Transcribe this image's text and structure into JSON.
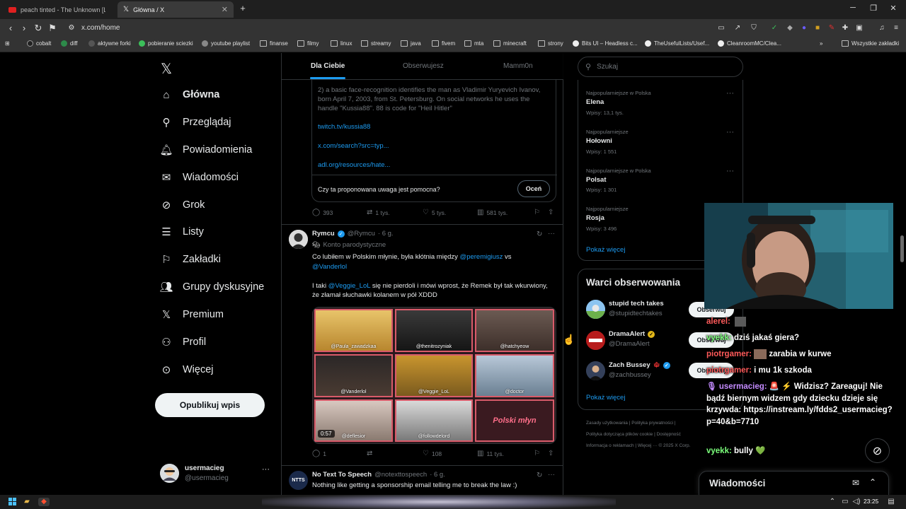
{
  "browser": {
    "tabs": [
      {
        "title": "peach tinted - The Unknown [Lyr"
      },
      {
        "title": "Główna / X"
      }
    ],
    "url": "x.com/home",
    "bookmarks": [
      "cobalt",
      "diff",
      "aktywne forki",
      "pobieranie sciezki",
      "youtube playlist",
      "finanse",
      "filmy",
      "linux",
      "streamy",
      "java",
      "fivem",
      "mta",
      "minecraft",
      "strony",
      "Bits UI – Headless c...",
      "TheUsefulLists/Usef...",
      "CleanroomMC/Clea...",
      "Wszystkie zakładki"
    ]
  },
  "sidebar": {
    "items": [
      {
        "label": "Główna",
        "icon": "home-icon"
      },
      {
        "label": "Przeglądaj",
        "icon": "search-icon"
      },
      {
        "label": "Powiadomienia",
        "icon": "bell-icon"
      },
      {
        "label": "Wiadomości",
        "icon": "mail-icon"
      },
      {
        "label": "Grok",
        "icon": "grok-icon"
      },
      {
        "label": "Listy",
        "icon": "list-icon"
      },
      {
        "label": "Zakładki",
        "icon": "bookmark-icon"
      },
      {
        "label": "Grupy dyskusyjne",
        "icon": "communities-icon"
      },
      {
        "label": "Premium",
        "icon": "x-logo-icon"
      },
      {
        "label": "Profil",
        "icon": "person-icon"
      },
      {
        "label": "Więcej",
        "icon": "more-circle-icon"
      }
    ],
    "post_button": "Opublikuj wpis",
    "account": {
      "name": "usermacieg",
      "handle": "@usermacieg"
    }
  },
  "feed": {
    "tabs": [
      "Dla Ciebie",
      "Obserwujesz",
      "Mamm0n"
    ],
    "note": {
      "text": "2) a basic face-recognition identifies the man as Vladimir Yuryevich Ivanov, born April 7, 2003, from St. Petersburg. On social networks he uses the handle \"Kussia88\". 88 is code for \"Heil Hitler\"",
      "links": [
        "twitch.tv/kussia88",
        "x.com/search?src=typ...",
        "adl.org/resources/hate..."
      ],
      "question": "Czy ta proponowana uwaga jest pomocna?",
      "rate_button": "Oceń"
    },
    "tweet1_actions": {
      "replies": "393",
      "reposts": "1 tys.",
      "likes": "5 tys.",
      "views": "581 tys."
    },
    "tweet2": {
      "name": "Rymcu",
      "handle": "@Rymcu",
      "time": "· 6 g.",
      "label": "Konto parodystyczne",
      "line1_a": "Co lubiłem w Polskim młynie, była kłótnia między ",
      "mention1": "@peremigiusz",
      "line1_b": " vs",
      "mention2": "@Vanderlol",
      "line2_a": "I taki ",
      "mention3": "@Veggie_LoL",
      "line2_b": " się nie pierdoli i mówi wprost, że Remek był tak wkurwiony, że złamał słuchawki kolanem w pół XDDD",
      "media_labels": [
        "@Paula_zawadzkaa",
        "@thenitrozyniak",
        "@hatchyeow",
        "@Vanderlol",
        "@Veggie_LoL",
        "@doctor",
        "@deflesior",
        "@followdelord",
        "Polski młyn"
      ],
      "duration": "0:57",
      "actions": {
        "replies": "1",
        "reposts": "",
        "likes": "108",
        "views": "11 tys."
      }
    },
    "tweet3": {
      "name": "No Text To Speech",
      "handle": "@notexttospeech",
      "time": "· 6 g.",
      "text": "Nothing like getting a sponsorship email telling me to break the law :)",
      "avatar_text": "NTTS"
    }
  },
  "right": {
    "search_placeholder": "Szukaj",
    "trends": [
      {
        "context": "Najpopularniejsze w Polska",
        "name": "Elena",
        "count": "Wpisy: 13,1 tys."
      },
      {
        "context": "Najpopularniejsze",
        "name": "Hołowni",
        "count": "Wpisy: 1 551"
      },
      {
        "context": "Najpopularniejsze w Polska",
        "name": "Polsat",
        "count": "Wpisy: 1 301"
      },
      {
        "context": "Najpopularniejsze",
        "name": "Rosja",
        "count": "Wpisy: 3 496"
      }
    ],
    "show_more": "Pokaż więcej",
    "wtf_title": "Warci obserwowania",
    "wtf": [
      {
        "name": "stupid tech takes",
        "handle": "@stupidtechtakes",
        "badge": ""
      },
      {
        "name": "DramaAlert",
        "handle": "@DramaAlert",
        "badge": "gold"
      },
      {
        "name": "Zach Bussey",
        "handle": "@zachbussey",
        "badge": "canada-blue"
      }
    ],
    "follow_label": "Obserwuj",
    "footer_1": "Zasady użytkowania  |  Polityka prywatności  |",
    "footer_2": "Polityka dotycząca plików cookie  |  Dostępność",
    "footer_3": "Informacja o reklamach  |  Więcej ···  © 2025 X Corp."
  },
  "chat": [
    {
      "user": "alerel:",
      "msg": "",
      "color": "red"
    },
    {
      "user": "vyekk:",
      "msg": "dziś jakaś giera?",
      "color": "green"
    },
    {
      "user": "piotrgamer:",
      "msg": "zarabia w kurwe",
      "color": "red"
    },
    {
      "user": "piotrgamer:",
      "msg": "i mu 1k szkoda",
      "color": "red"
    },
    {
      "user": "usermacieg:",
      "msg": "🚨 ⚡ Widzisz? Zareaguj! Nie bądź biernym widzem gdy dziecku dzieje się krzywda: https://instream.ly/fdds2_usermacieg?p=40&b=7710",
      "color": "purple"
    },
    {
      "user": "vyekk:",
      "msg": "bully 💚",
      "color": "green"
    }
  ],
  "messages_drawer": "Wiadomości",
  "taskbar": {
    "time": "23:25"
  }
}
